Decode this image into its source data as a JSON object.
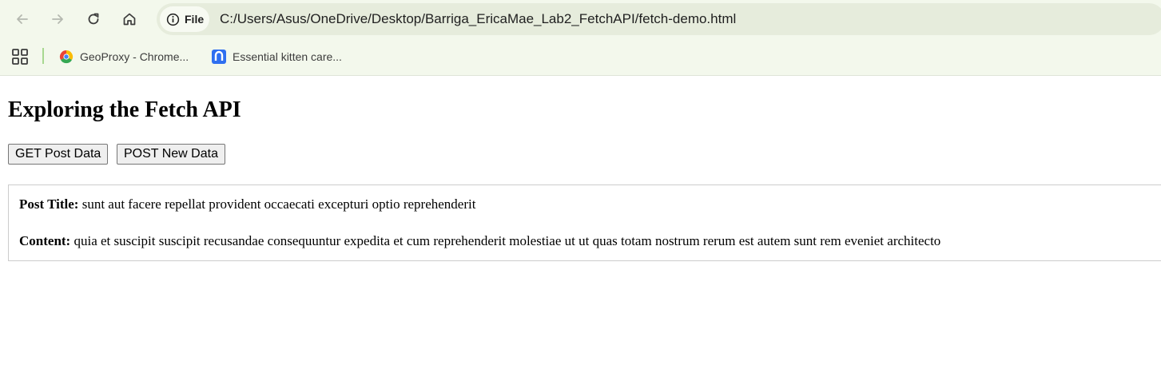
{
  "browser": {
    "address_chip_label": "File",
    "url": "C:/Users/Asus/OneDrive/Desktop/Barriga_EricaMae_Lab2_FetchAPI/fetch-demo.html",
    "bookmarks": [
      {
        "label": "GeoProxy - Chrome...",
        "icon": "chrome-icon"
      },
      {
        "label": "Essential kitten care...",
        "icon": "n-app-icon"
      }
    ]
  },
  "page": {
    "title": "Exploring the Fetch API",
    "buttons": {
      "get_label": "GET Post Data",
      "post_label": "POST New Data"
    },
    "result": {
      "title_label": "Post Title:",
      "title_value": "sunt aut facere repellat provident occaecati excepturi optio reprehenderit",
      "content_label": "Content:",
      "content_value": "quia et suscipit suscipit recusandae consequuntur expedita et cum reprehenderit molestiae ut ut quas totam nostrum rerum est autem sunt rem eveniet architecto"
    }
  },
  "colors": {
    "toolbar_bg": "#f3f8ec",
    "omnibox_bg": "#e6ecdc",
    "button_bg": "#efefef",
    "result_border": "#cccccc"
  }
}
